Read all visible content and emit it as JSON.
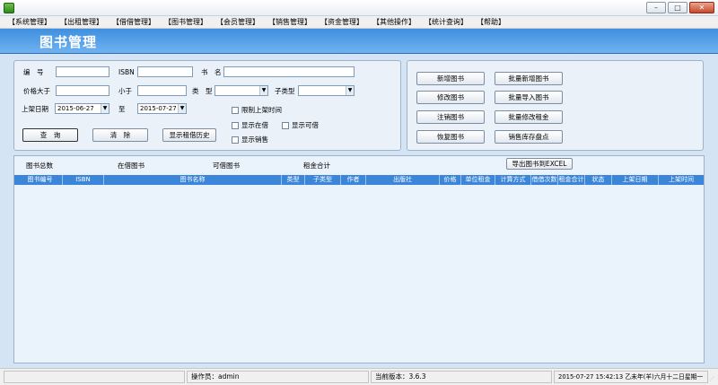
{
  "menu": [
    "【系统管理】",
    "【出租管理】",
    "【借借管理】",
    "【图书管理】",
    "【会员管理】",
    "【销售管理】",
    "【资金管理】",
    "【其他操作】",
    "【统计查询】",
    "【帮助】"
  ],
  "header": {
    "title": "图书管理"
  },
  "search": {
    "number_label": "编　号",
    "isbn_label": "ISBN",
    "name_label": "书　名",
    "price_gt_label": "价格大于",
    "price_lt_label": "小于",
    "type_label": "类　型",
    "subtype_label": "子类型",
    "date_label": "上架日期",
    "date_from": "2015-06-27",
    "to_label": "至",
    "date_to": "2015-07-27",
    "chk_limit_date": "限制上架时间",
    "chk_in_borrow": "显示在借",
    "chk_can_borrow": "显示可借",
    "chk_sold": "显示销售",
    "query_btn": "查　询",
    "clear_btn": "清　除",
    "history_btn": "显示租借历史"
  },
  "actions": {
    "add": "新增图书",
    "batch_add": "批量新增图书",
    "edit": "修改图书",
    "batch_import": "批量导入图书",
    "cancel": "注销图书",
    "batch_edit_rent": "批量修改租金",
    "restore": "恢复图书",
    "inventory": "销售库存盘点"
  },
  "summary": {
    "total": "图书总数",
    "in_borrow": "在借图书",
    "can_borrow": "可借图书",
    "rent_total": "租金合计",
    "export_btn": "导出图书到EXCEL"
  },
  "columns": [
    "图书编号",
    "ISBN",
    "图书名称",
    "类型",
    "子类型",
    "作者",
    "出版社",
    "价格",
    "单位租金",
    "计算方式",
    "借借次数",
    "租金合计",
    "状态",
    "上架日期",
    "上架时间"
  ],
  "status": {
    "operator": "操作员：admin",
    "version": "当前版本：3.6.3",
    "datetime": "2015-07-27 15:42:13 乙未年(羊)六月十二日星期一"
  },
  "colors": {
    "header": "#4a94e3",
    "table_header": "#3b86d8"
  }
}
